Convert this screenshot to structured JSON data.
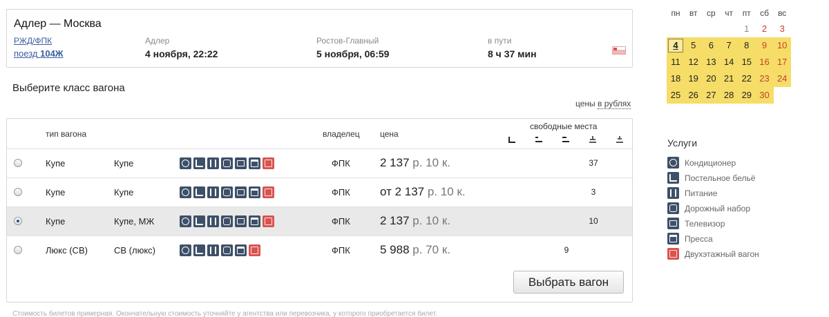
{
  "trip": {
    "route": "Адлер — Москва",
    "carrier": "РЖД/ФПК",
    "train_prefix": "поезд",
    "train_number": "104Ж",
    "from_label": "Адлер",
    "from_time": "4 ноября, 22:22",
    "to_label": "Ростов-Главный",
    "to_time": "5 ноября, 06:59",
    "duration_label": "в пути",
    "duration": "8 ч 37 мин"
  },
  "choose_title": "Выберите класс вагона",
  "prices_prefix": "цены",
  "prices_link": "в рублях",
  "table": {
    "headers": {
      "type": "тип вагона",
      "owner": "владелец",
      "price": "цена",
      "free_seats": "свободные места"
    },
    "rows": [
      {
        "type": "Купе",
        "class": "Купе",
        "owner": "ФПК",
        "price_prefix": "",
        "price_main": "2 137",
        "price_rub": "р. 10 к.",
        "seats": "37",
        "seat_col": 3,
        "selected": false,
        "services": [
          "fan",
          "bed",
          "food",
          "kit",
          "tv",
          "press",
          "double"
        ]
      },
      {
        "type": "Купе",
        "class": "Купе",
        "owner": "ФПК",
        "price_prefix": "от ",
        "price_main": "2 137",
        "price_rub": "р. 10 к.",
        "seats": "3",
        "seat_col": 3,
        "selected": false,
        "services": [
          "fan",
          "bed",
          "food",
          "kit",
          "tv",
          "press",
          "double"
        ]
      },
      {
        "type": "Купе",
        "class": "Купе, МЖ",
        "owner": "ФПК",
        "price_prefix": "",
        "price_main": "2 137",
        "price_rub": "р. 10 к.",
        "seats": "10",
        "seat_col": 3,
        "selected": true,
        "services": [
          "fan",
          "bed",
          "food",
          "kit",
          "tv",
          "press",
          "double"
        ]
      },
      {
        "type": "Люкс (СВ)",
        "class": "СВ (люкс)",
        "owner": "ФПК",
        "price_prefix": "",
        "price_main": "5 988",
        "price_rub": "р. 70 к.",
        "seats": "9",
        "seat_col": 2,
        "selected": false,
        "services": [
          "fan",
          "bed",
          "food",
          "kit",
          "press",
          "double"
        ]
      }
    ],
    "button_label": "Выбрать вагон"
  },
  "note": "Стоимость билетов примерная. Окончательную стоимость уточняйте у агентства или перевозчика, у которого приобретается билет.",
  "calendar": {
    "weekdays": [
      "пн",
      "вт",
      "ср",
      "чт",
      "пт",
      "сб",
      "вс"
    ],
    "today": "4",
    "weeks": [
      [
        null,
        null,
        null,
        null,
        "1",
        "2",
        "3"
      ],
      [
        "4",
        "5",
        "6",
        "7",
        "8",
        "9",
        "10"
      ],
      [
        "11",
        "12",
        "13",
        "14",
        "15",
        "16",
        "17"
      ],
      [
        "18",
        "19",
        "20",
        "21",
        "22",
        "23",
        "24"
      ],
      [
        "25",
        "26",
        "27",
        "28",
        "29",
        "30",
        null
      ]
    ]
  },
  "services": {
    "title": "Услуги",
    "items": [
      {
        "icon": "fan-icon",
        "label": "Кондиционер"
      },
      {
        "icon": "bed-icon",
        "label": "Постельное бельё"
      },
      {
        "icon": "food-icon",
        "label": "Питание"
      },
      {
        "icon": "kit-icon",
        "label": "Дорожный набор"
      },
      {
        "icon": "tv-icon",
        "label": "Телевизор"
      },
      {
        "icon": "press-icon",
        "label": "Пресса"
      },
      {
        "icon": "double-deck-icon",
        "label": "Двухэтажный вагон"
      }
    ]
  },
  "colors": {
    "link": "#3a5c9e",
    "calendar_highlight": "#f5dd68",
    "weekend": "#c8402a",
    "icon_dark": "#3e5068",
    "icon_red": "#d9534f"
  }
}
